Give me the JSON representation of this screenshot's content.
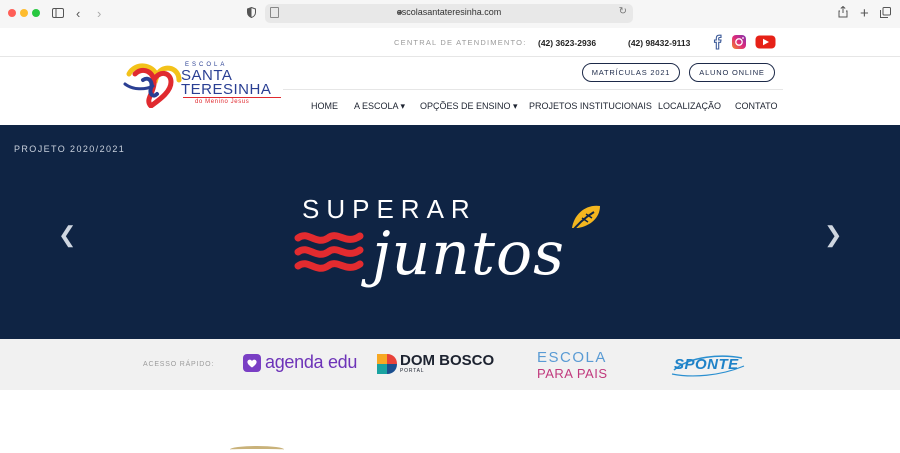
{
  "browser": {
    "url": "escolasantateresinha.com"
  },
  "contact": {
    "central_label": "CENTRAL DE ATENDIMENTO:",
    "phone": "(42) 3623-2936",
    "whatsapp": "(42) 98432-9113"
  },
  "logo": {
    "escola": "ESCOLA",
    "name_line1": "SANTA",
    "name_line2": "TERESINHA",
    "tagline": "do Menino Jesus"
  },
  "header_buttons": {
    "matriculas": "MATRÍCULAS 2021",
    "aluno": "ALUNO ONLINE"
  },
  "nav": [
    {
      "label": "HOME"
    },
    {
      "label": "A ESCOLA ▾"
    },
    {
      "label": "OPÇÕES DE ENSINO ▾"
    },
    {
      "label": "PROJETOS INSTITUCIONAIS"
    },
    {
      "label": "LOCALIZAÇÃO"
    },
    {
      "label": "CONTATO"
    }
  ],
  "hero": {
    "subtitle": "PROJETO 2020/2021",
    "title_top": "SUPERAR",
    "title_script": "juntos",
    "bg_color": "#0f2444",
    "accent_red": "#e32b2f",
    "accent_yellow": "#f3b61f"
  },
  "quick_access": {
    "label": "ACESSO RÁPIDO:",
    "agenda": "agenda edu",
    "dombosco": "DOM BOSCO",
    "dombosco_sub": "PORTAL",
    "escola_line1": "ESCOLA",
    "escola_line2": "PARA PAIS",
    "sponte": "SPONTE"
  }
}
